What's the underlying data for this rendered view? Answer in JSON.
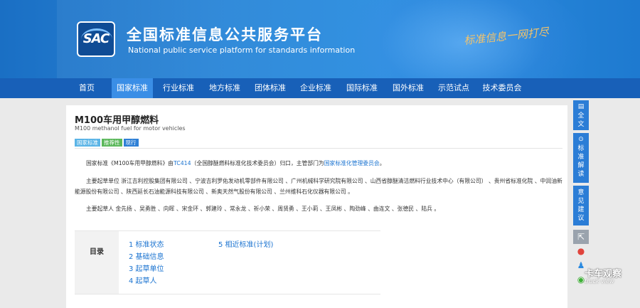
{
  "header": {
    "logo_text": "SAC",
    "title_cn": "全国标准信息公共服务平台",
    "title_en": "National public service platform  for standards information",
    "slogan": "标准信息一网打尽"
  },
  "nav": {
    "items": [
      "首页",
      "国家标准",
      "行业标准",
      "地方标准",
      "团体标准",
      "企业标准",
      "国际标准",
      "国外标准",
      "示范试点",
      "技术委员会"
    ],
    "active": "国家标准"
  },
  "standard": {
    "title": "M100车用甲醇燃料",
    "title_en": "M100 methanol fuel for motor vehicles",
    "badges": [
      {
        "label": "国家标准",
        "color": "#5ab4e6"
      },
      {
        "label": "推荐性",
        "color": "#5cb85c"
      },
      {
        "label": "现行",
        "color": "#2f80d6"
      }
    ],
    "intro": {
      "prefix": "国家标准《M100车用甲醇燃料》由",
      "tc_link": "TC414",
      "middle": "（全国醇醚燃料标准化技术委员会）归口，主管部门为",
      "dept_link": "国家标准化管理委员会",
      "suffix": "。"
    },
    "drafting_units": "主要起草单位 浙江吉利控股集团有限公司 、宁波吉利罗佑发动机零部件有限公司 、广州机械科学研究院有限公司 、山西省醇醚清洁燃料行业技术中心（有限公司） 、贵州省标准化院 、中润油新能源股份有限公司 、陕西延长石油能源科技有限公司 、新奥天然气股份有限公司 、兰州维科石化仪器有限公司 。",
    "drafters": "主要起草人 金先扬 、吴勇胜 、向晖 、宋金环 、郭建玲 、常永龙 、祈小荣 、周贤勇 、王小莉 、王凤彬 、陶劲峰 、曲连文 、张德民 、陆兵 。"
  },
  "toc": {
    "label": "目录",
    "items": [
      "1  标准状态",
      "2  基础信息",
      "3  起草单位",
      "4  起草人",
      "5  相近标准(计划)"
    ]
  },
  "sidebar": {
    "full_text": "全文",
    "interpretation": "标准解读",
    "feedback": "意见建议"
  },
  "watermark": {
    "cn": "卡车观察",
    "en": "truck view"
  }
}
